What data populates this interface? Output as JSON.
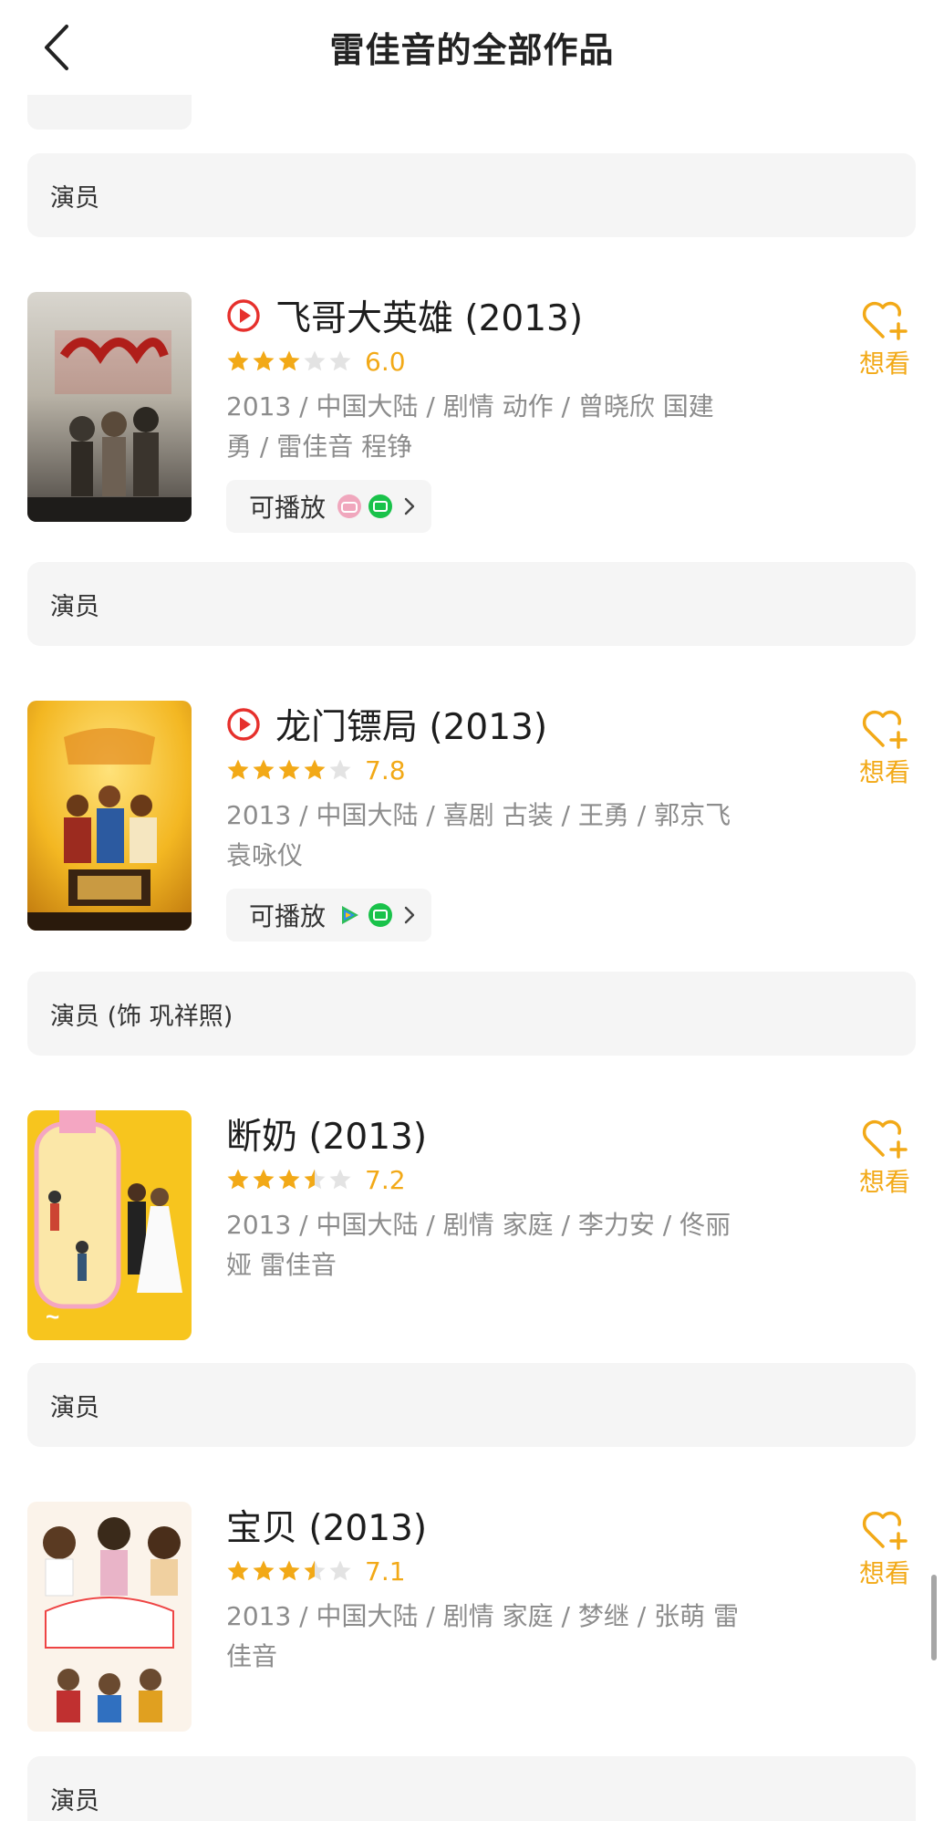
{
  "header": {
    "title": "雷佳音的全部作品"
  },
  "sections": [
    {
      "role": "演员",
      "movie": {
        "title": "飞哥大英雄 (2013)",
        "has_play_icon": true,
        "stars": 3,
        "score": "6.0",
        "meta_line1": "2013 / 中国大陆 / 剧情 动作 / 曾晓欣 国建",
        "meta_line2": "勇 / 雷佳音 程铮",
        "playable_label": "可播放",
        "platforms": [
          "bilibili-icon",
          "iqiyi-icon"
        ],
        "want_label": "想看"
      }
    },
    {
      "role": "演员",
      "movie": {
        "title": "龙门镖局 (2013)",
        "has_play_icon": true,
        "stars": 4,
        "score": "7.8",
        "meta_line1": "2013 / 中国大陆 / 喜剧 古装 / 王勇 / 郭京飞",
        "meta_line2": "袁咏仪",
        "playable_label": "可播放",
        "platforms": [
          "tencent-video-icon",
          "iqiyi-icon"
        ],
        "want_label": "想看"
      }
    },
    {
      "role": "演员 (饰 巩祥照)",
      "movie": {
        "title": "断奶 (2013)",
        "has_play_icon": false,
        "stars": 3.5,
        "score": "7.2",
        "meta_line1": "2013 / 中国大陆 / 剧情 家庭 / 李力安 / 佟丽",
        "meta_line2": "娅 雷佳音",
        "want_label": "想看"
      }
    },
    {
      "role": "演员",
      "movie": {
        "title": "宝贝 (2013)",
        "has_play_icon": false,
        "stars": 3.5,
        "score": "7.1",
        "meta_line1": "2013 / 中国大陆 / 剧情 家庭 / 梦继 / 张萌 雷",
        "meta_line2": "佳音",
        "want_label": "想看"
      }
    },
    {
      "role": "演员"
    }
  ],
  "colors": {
    "accent": "#f2a917",
    "play_red": "#e6302c",
    "bar_bg": "#f5f5f5"
  }
}
